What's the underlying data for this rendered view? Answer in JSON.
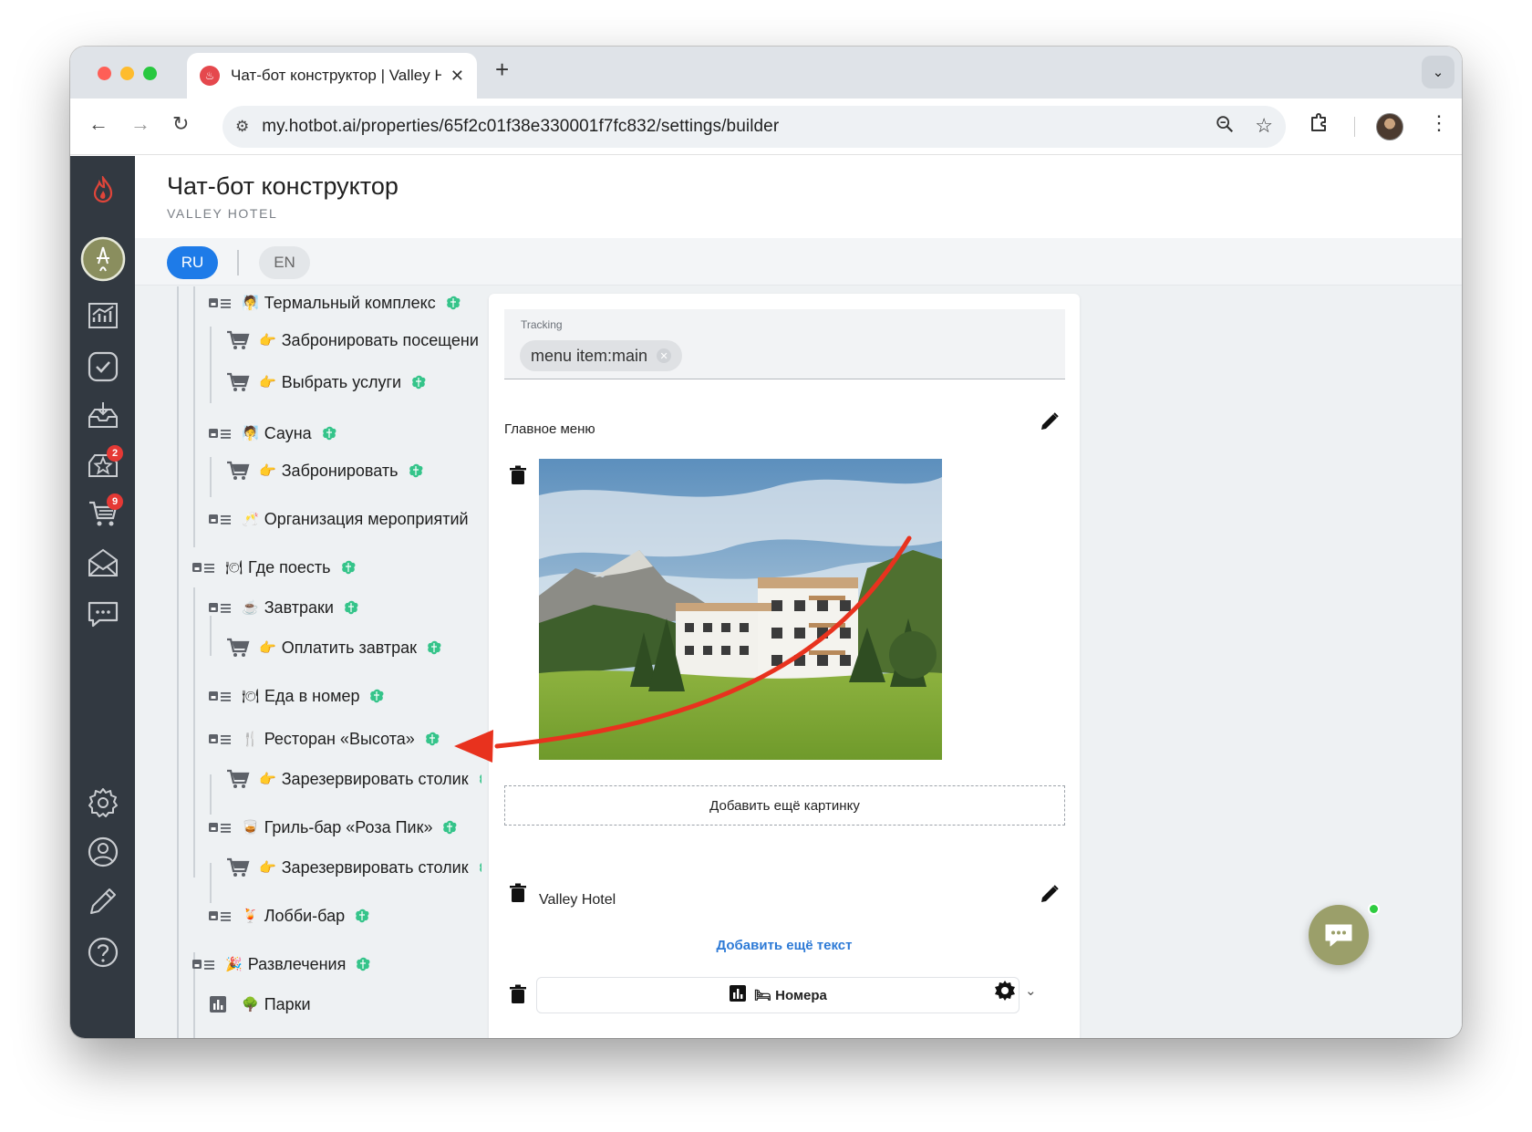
{
  "browser": {
    "tab_title": "Чат-бот конструктор | Valley Hotel",
    "url": "my.hotbot.ai/properties/65f2c01f38e330001f7fc832/settings/builder"
  },
  "header": {
    "title": "Чат-бот конструктор",
    "subtitle": "VALLEY HOTEL"
  },
  "languages": {
    "active": "RU",
    "other": "EN"
  },
  "rail": {
    "badge_reviews": "2",
    "badge_orders": "9"
  },
  "tree": {
    "items": [
      {
        "label": "Термальный комплекс",
        "emoji": "🧖"
      },
      {
        "label": "Забронировать посещени",
        "emoji": "👉"
      },
      {
        "label": "Выбрать услуги",
        "emoji": "👉"
      },
      {
        "label": "Сауна",
        "emoji": "🧖"
      },
      {
        "label": "Забронировать",
        "emoji": "👉"
      },
      {
        "label": "Организация мероприятий",
        "emoji": "🥂"
      },
      {
        "label": "Где поесть",
        "emoji": "🍽"
      },
      {
        "label": "Завтраки",
        "emoji": "☕"
      },
      {
        "label": "Оплатить завтрак",
        "emoji": "👉"
      },
      {
        "label": "Еда в номер",
        "emoji": "🍽"
      },
      {
        "label": "Ресторан «Высота»",
        "emoji": "🍴"
      },
      {
        "label": "Зарезервировать столик",
        "emoji": "👉"
      },
      {
        "label": "Гриль-бар «Роза Пик»",
        "emoji": "🥃"
      },
      {
        "label": "Зарезервировать столик",
        "emoji": "👉"
      },
      {
        "label": "Лобби-бар",
        "emoji": "🍹"
      },
      {
        "label": "Развлечения",
        "emoji": "🎉"
      },
      {
        "label": "Парки",
        "emoji": "🌳"
      }
    ]
  },
  "editor": {
    "tracking_label": "Tracking",
    "tracking_chip": "menu item:main",
    "block_title": "Главное меню",
    "add_image": "Добавить ещё картинку",
    "text_value": "Valley Hotel",
    "add_text": "Добавить ещё текст",
    "button_label": "Номера",
    "button_emoji": "🛏"
  },
  "colors": {
    "rail_bg": "#323941",
    "accent_blue": "#1e7be8",
    "brain_green": "#35c48a",
    "annotation_red": "#e8321e",
    "chat_widget": "#9b9f6a"
  }
}
